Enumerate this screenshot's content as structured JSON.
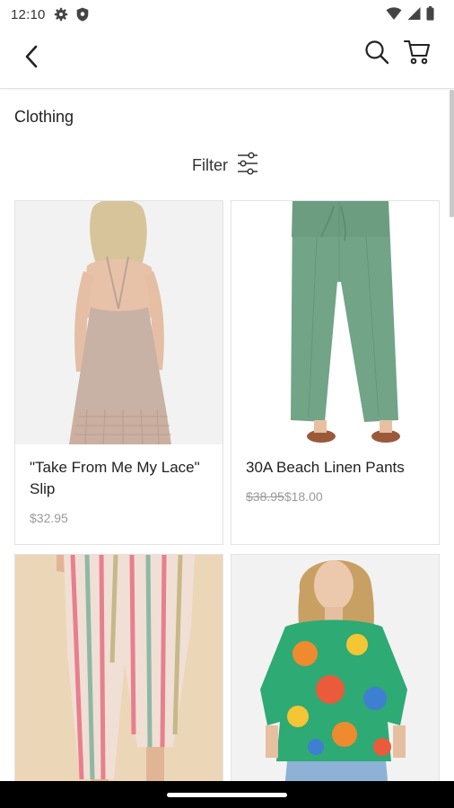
{
  "status_bar": {
    "time": "12:10",
    "icons_left": [
      "gear-icon",
      "shield-icon"
    ],
    "icons_right": [
      "wifi-icon",
      "signal-icon",
      "battery-icon"
    ]
  },
  "app_bar": {
    "icons": [
      "back-arrow-icon",
      "search-icon",
      "cart-icon"
    ]
  },
  "page": {
    "title": "Clothing",
    "filter_label": "Filter"
  },
  "products": [
    {
      "name": "\"Take From Me My Lace\" Slip",
      "price": "$32.95",
      "old_price": ""
    },
    {
      "name": "30A Beach Linen Pants",
      "price": "$18.00",
      "old_price": "$38.95"
    },
    {
      "name": "",
      "price": "",
      "old_price": ""
    },
    {
      "name": "",
      "price": "",
      "old_price": ""
    }
  ],
  "colors": {
    "text": "#222222",
    "muted_price": "#9a9a9a",
    "divider": "#e2e2e2",
    "nav_bar": "#000000"
  }
}
